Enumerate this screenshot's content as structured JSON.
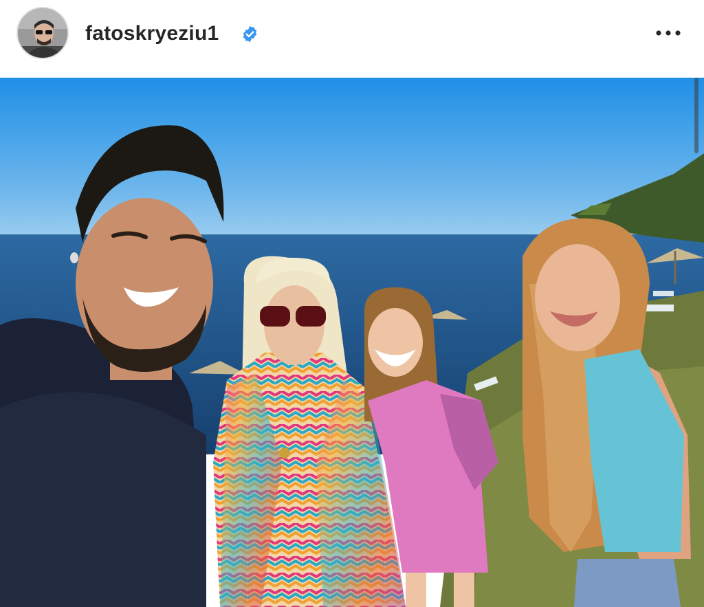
{
  "post": {
    "username": "fatoskryeziu1",
    "verified": true,
    "verified_color": "#3897f0",
    "icons": {
      "verified": "verified-badge-icon",
      "more": "more-options-icon"
    }
  },
  "photo": {
    "colors": {
      "sky_top": "#1f8fe6",
      "sky_bottom": "#b8dcf2",
      "sea": "#1d4f86",
      "grass": "#6e7a3c"
    }
  }
}
